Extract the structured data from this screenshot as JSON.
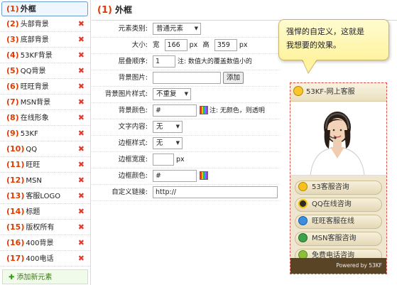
{
  "sidebar": {
    "items": [
      {
        "num": "(1)",
        "label": "外框"
      },
      {
        "num": "(2)",
        "label": "头部背景"
      },
      {
        "num": "(3)",
        "label": "底部背景"
      },
      {
        "num": "(4)",
        "label": "53KF背景"
      },
      {
        "num": "(5)",
        "label": "QQ背景"
      },
      {
        "num": "(6)",
        "label": "旺旺背景"
      },
      {
        "num": "(7)",
        "label": "MSN背景"
      },
      {
        "num": "(8)",
        "label": "在线形象"
      },
      {
        "num": "(9)",
        "label": "53KF"
      },
      {
        "num": "(10)",
        "label": "QQ"
      },
      {
        "num": "(11)",
        "label": "旺旺"
      },
      {
        "num": "(12)",
        "label": "MSN"
      },
      {
        "num": "(13)",
        "label": "客服LOGO"
      },
      {
        "num": "(14)",
        "label": "标题"
      },
      {
        "num": "(15)",
        "label": "版权所有"
      },
      {
        "num": "(16)",
        "label": "400背景"
      },
      {
        "num": "(17)",
        "label": "400电话"
      }
    ],
    "delete_glyph": "✖",
    "add_new": {
      "plus": "✚",
      "label": "添加新元素"
    }
  },
  "main": {
    "title_num": "(1)",
    "title": "外框"
  },
  "form": {
    "element_type": {
      "label": "元素类别:",
      "value": "普通元素"
    },
    "size": {
      "label": "大小:",
      "width_label": "宽",
      "width": "166",
      "unit1": "px",
      "height_label": "高",
      "height": "359",
      "unit2": "px"
    },
    "layer": {
      "label": "层叠顺序:",
      "value": "1",
      "note": "注: 数值大的覆盖数值小的"
    },
    "bg_image": {
      "label": "背景图片:",
      "value": "",
      "button": "添加"
    },
    "bg_image_style": {
      "label": "背景图片样式:",
      "value": "不重复"
    },
    "bg_color": {
      "label": "背景颜色:",
      "value": "#",
      "note": "注: 无颜色，则透明"
    },
    "text_content": {
      "label": "文字内容:",
      "value": "无"
    },
    "border_style": {
      "label": "边框样式:",
      "value": "无"
    },
    "border_width": {
      "label": "边框宽度:",
      "value": "",
      "unit": "px"
    },
    "border_color": {
      "label": "边框颜色:",
      "value": "#"
    },
    "custom_link": {
      "label": "自定义链接:",
      "value": "http://"
    }
  },
  "callout": {
    "text_line1": "强悍的自定义，这就是",
    "text_line2": "我想要的效果。"
  },
  "widget": {
    "header": "53KF-网上客服",
    "items": [
      {
        "label": "53客服咨询",
        "icon": "smile-icon",
        "color": "#f6c21c"
      },
      {
        "label": "QQ在线咨询",
        "icon": "qq-penguin-icon",
        "color": "#2a2a2a"
      },
      {
        "label": "旺旺客服在线",
        "icon": "wangwang-icon",
        "color": "#3b8de0"
      },
      {
        "label": "MSN客服咨询",
        "icon": "msn-buddy-icon",
        "color": "#3da34a"
      },
      {
        "label": "免费电话咨询",
        "icon": "phone-icon",
        "color": "#8fbf3a"
      }
    ],
    "footer": "Powered by 53KF"
  }
}
